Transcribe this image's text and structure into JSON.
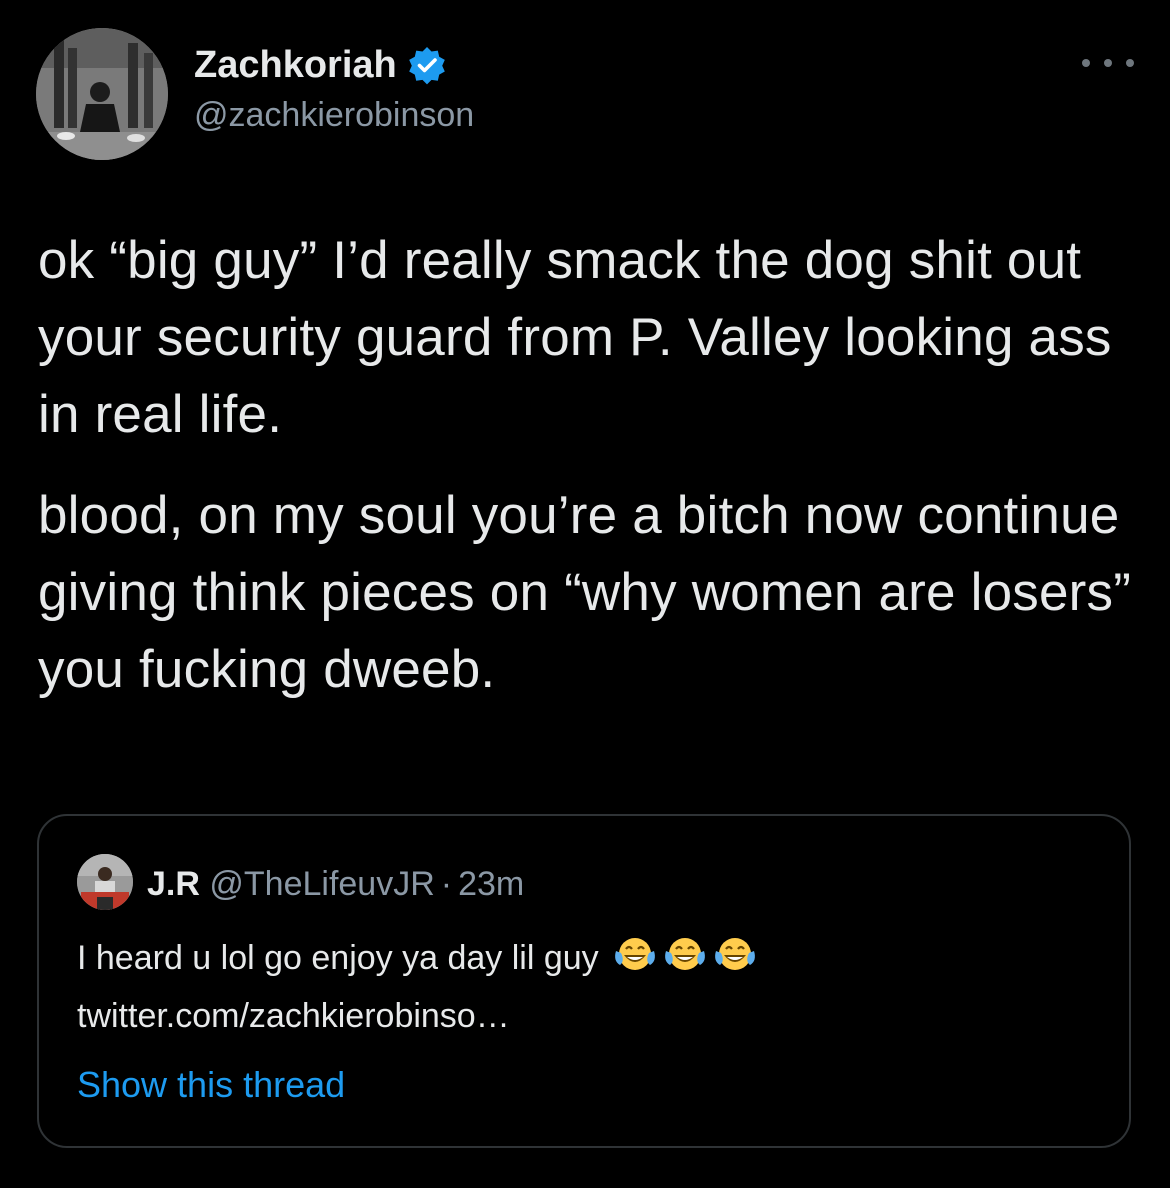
{
  "author": {
    "display_name": "Zachkoriah",
    "handle": "@zachkierobinson",
    "verified": true,
    "avatar_icon": "profile-photo",
    "verified_icon": "verified-badge-icon"
  },
  "more_icon": "more-horizontal-icon",
  "tweet": {
    "paragraphs": [
      "ok “big guy” I’d really smack the dog shit out your security guard from P. Valley looking ass in real life.",
      "blood, on my soul you’re a bitch now continue giving think pieces on “why women are losers” you fucking dweeb."
    ]
  },
  "quoted": {
    "name": "J.R",
    "handle": "@TheLifeuvJR",
    "separator": "·",
    "time": "23m",
    "text": "I heard u lol go enjoy ya day lil guy",
    "emoji_icon": "face-with-tears-of-joy-icon",
    "emoji_count": 3,
    "link": "twitter.com/zachkierobinso…",
    "show_thread": "Show this thread"
  },
  "colors": {
    "background": "#000000",
    "text_primary": "#e7e9ea",
    "text_secondary": "#8b98a5",
    "link": "#1d9bf0",
    "border": "#2f3336",
    "verified": "#1d9bf0"
  }
}
